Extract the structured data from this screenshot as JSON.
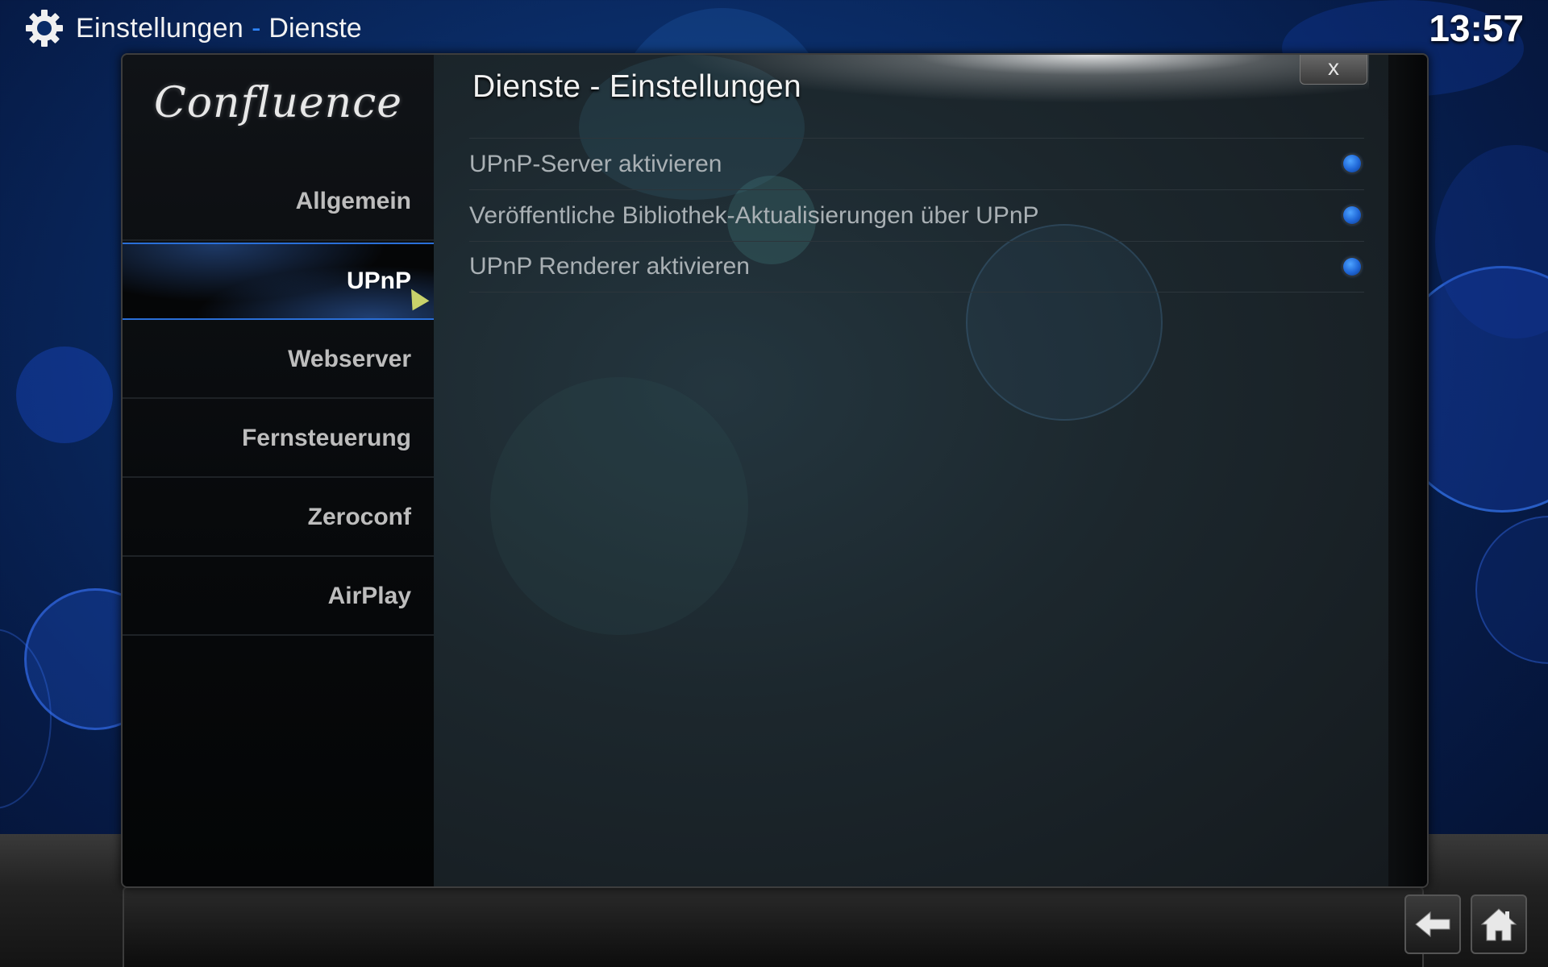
{
  "header": {
    "title": "Einstellungen",
    "separator": "-",
    "subtitle": "Dienste",
    "clock": "13:57"
  },
  "dialog": {
    "logo": "Confluence",
    "heading": "Dienste - Einstellungen",
    "close_label": "x"
  },
  "sidebar": {
    "active": "UPnP",
    "items": [
      {
        "label": "Allgemein"
      },
      {
        "label": "UPnP"
      },
      {
        "label": "Webserver"
      },
      {
        "label": "Fernsteuerung"
      },
      {
        "label": "Zeroconf"
      },
      {
        "label": "AirPlay"
      }
    ]
  },
  "settings": [
    {
      "label": "UPnP-Server aktivieren",
      "enabled": true
    },
    {
      "label": "Veröffentliche Bibliothek-Aktualisierungen über UPnP",
      "enabled": true
    },
    {
      "label": "UPnP Renderer aktivieren",
      "enabled": true
    }
  ],
  "colors": {
    "accent": "#2f86ff",
    "radio_on": "#1f66d6"
  },
  "icons": {
    "settings": "gear-icon",
    "close": "close-icon",
    "back": "back-arrow-icon",
    "home": "home-icon"
  }
}
